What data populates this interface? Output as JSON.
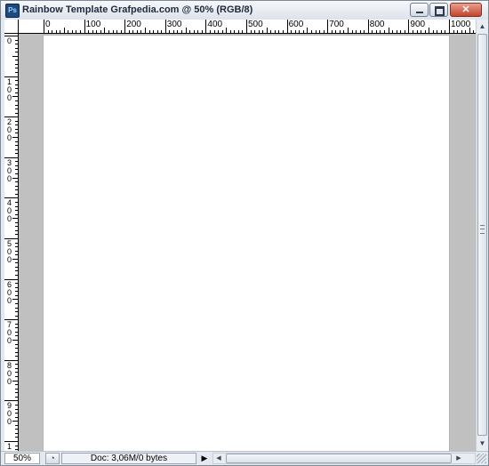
{
  "window": {
    "app_icon_text": "Ps",
    "title": "Rainbow Template Grafpedia.com @ 50% (RGB/8)",
    "buttons": {
      "minimize": "minimize-icon",
      "maximize": "maximize-icon",
      "close": "close-icon"
    }
  },
  "rulers": {
    "horizontal_labels": [
      "0",
      "100",
      "200",
      "300",
      "400",
      "500",
      "600",
      "700",
      "800",
      "900",
      "1000"
    ],
    "vertical_labels": [
      "0",
      "1\n0\n0",
      "2\n0\n0",
      "3\n0\n0",
      "4\n0\n0",
      "5\n0\n0",
      "6\n0\n0",
      "7\n0\n0",
      "8\n0\n0",
      "9\n0\n0",
      "1"
    ]
  },
  "status": {
    "zoom": "50%",
    "doc_info": "Doc: 3,06M/0 bytes"
  },
  "colors": {
    "canvas": "#ffffff",
    "pasteboard": "#c0c0c0"
  }
}
